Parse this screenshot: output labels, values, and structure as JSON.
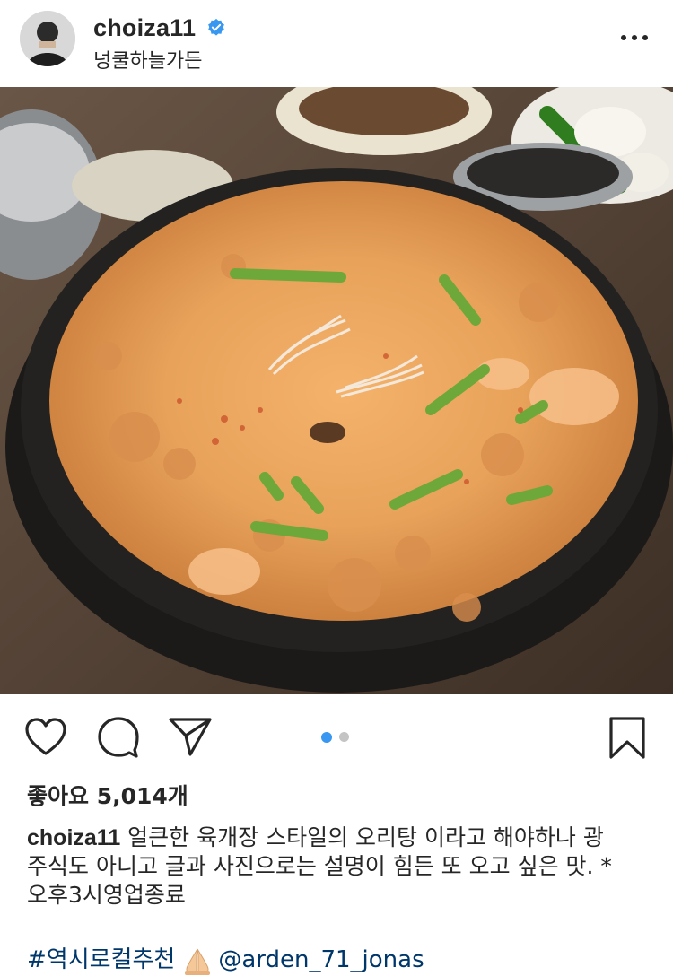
{
  "header": {
    "username": "choiza11",
    "location": "넝쿨하늘가든",
    "avatar_icon": "avatar-icon",
    "verified_icon": "verified-badge-icon",
    "more_icon": "more-options-icon"
  },
  "photo": {
    "subject": "food-photo",
    "carousel_position": 1,
    "carousel_count": 2
  },
  "actions": {
    "like_icon": "heart-icon",
    "comment_icon": "comment-icon",
    "share_icon": "paper-plane-icon",
    "save_icon": "bookmark-icon"
  },
  "likes": {
    "text": "좋아요 5,014개"
  },
  "caption": {
    "username": "choiza11",
    "line1": " 얼큰한 육개장 스타일의 오리탕 이라고 해야하나 광",
    "line2": "주식도 아니고 글과 사진으로는 설명이 힘든 또 오고 싶은 맛. *",
    "line3": "오후3시영업종료"
  },
  "tags": {
    "hashtag": "#역시로컬추천",
    "mention": "@arden_71_jonas",
    "emoji_icon": "praying-hands-icon"
  },
  "colors": {
    "text": "#262626",
    "link": "#00376b",
    "verified": "#3897f0",
    "dot_active": "#3897f0",
    "dot_inactive": "#c4c4c4"
  }
}
